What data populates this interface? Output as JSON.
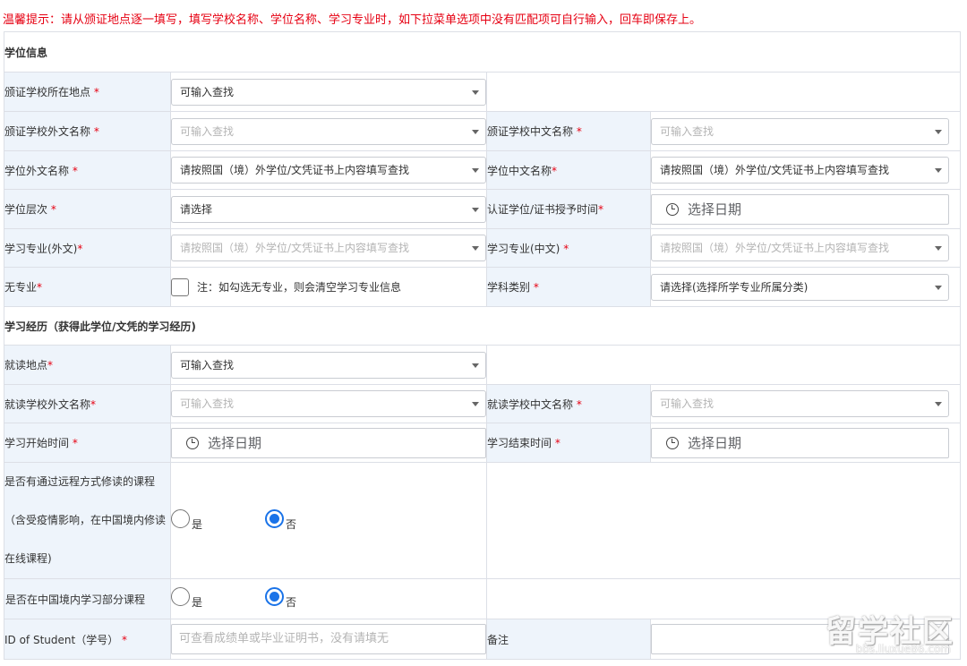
{
  "notice": "温馨提示：请从颁证地点逐一填写，填写学校名称、学位名称、学习专业时，如下拉菜单选项中没有匹配项可自行输入，回车即保存上。",
  "degree_section": {
    "title": "学位信息",
    "school_location": {
      "label": "颁证学校所在地点",
      "req": "*",
      "value": "可输入查找"
    },
    "school_foreign_name": {
      "label": "颁证学校外文名称",
      "req": "*",
      "placeholder": "可输入查找"
    },
    "school_chinese_name": {
      "label": "颁证学校中文名称",
      "req": "*",
      "placeholder": "可输入查找"
    },
    "degree_foreign_name": {
      "label": "学位外文名称",
      "req": "*",
      "value": "请按照国（境）外学位/文凭证书上内容填写查找"
    },
    "degree_chinese_name": {
      "label": "学位中文名称",
      "req": "*",
      "value": "请按照国（境）外学位/文凭证书上内容填写查找"
    },
    "degree_level": {
      "label": "学位层次",
      "req": "*",
      "value": "请选择"
    },
    "award_date": {
      "label": "认证学位/证书授予时间",
      "req": "*",
      "placeholder": "选择日期"
    },
    "major_foreign": {
      "label": "学习专业(外文)",
      "req": "*",
      "placeholder": "请按照国（境）外学位/文凭证书上内容填写查找"
    },
    "major_chinese": {
      "label": "学习专业(中文)",
      "req": "*",
      "placeholder": "请按照国（境）外学位/文凭证书上内容填写查找"
    },
    "no_major": {
      "label": "无专业",
      "req": "*",
      "note": "注：如勾选无专业，则会清空学习专业信息"
    },
    "discipline": {
      "label": "学科类别",
      "req": "*",
      "value": "请选择(选择所学专业所属分类)"
    }
  },
  "study_section": {
    "title": "学习经历（获得此学位/文凭的学习经历)",
    "study_location": {
      "label": "就读地点",
      "req": "*",
      "value": "可输入查找"
    },
    "school_foreign_name": {
      "label": "就读学校外文名称",
      "req": "*",
      "placeholder": "可输入查找"
    },
    "school_chinese_name": {
      "label": "就读学校中文名称",
      "req": "*",
      "placeholder": "可输入查找"
    },
    "start_date": {
      "label": "学习开始时间",
      "req": "*",
      "placeholder": "选择日期"
    },
    "end_date": {
      "label": "学习结束时间",
      "req": "*",
      "placeholder": "选择日期"
    },
    "remote": {
      "label": "是否有通过远程方式修读的课程（含受疫情影响，在中国境内修读在线课程)",
      "yes": "是",
      "no": "否",
      "selected": "no"
    },
    "in_china": {
      "label": "是否在中国境内学习部分课程",
      "yes": "是",
      "no": "否",
      "selected": "no"
    },
    "student_id": {
      "label": "ID of Student（学号）",
      "req": "*",
      "placeholder": "可查看成绩单或毕业证明书，没有请填无"
    },
    "remark": {
      "label": "备注"
    }
  },
  "watermark": {
    "main": "留学社区",
    "sub": "bbs.liuxue86.com"
  },
  "colors": {
    "required": "#e60012",
    "label_bg": "#eef4fb",
    "radio_accent": "#1a73e8",
    "border": "#dcdfe6"
  }
}
